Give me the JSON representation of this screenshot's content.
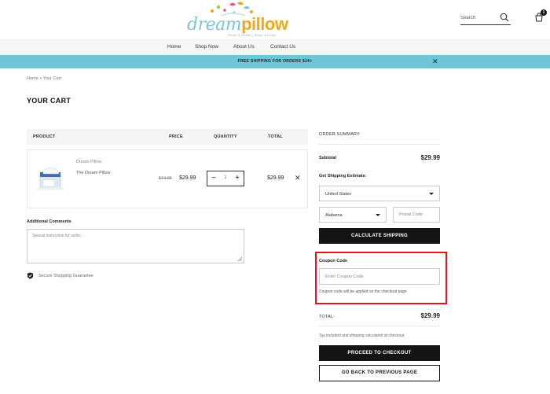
{
  "header": {
    "logo": {
      "part1": "dream",
      "part2": "pillow",
      "tagline": "Relax & Dream | Sleep & Enjoy",
      "colors": {
        "part1": "#7ec3d6",
        "part2": "#f2a81d"
      }
    },
    "search": {
      "placeholder": "Search",
      "icon": "search-icon"
    },
    "cart": {
      "icon": "bag-icon",
      "count": "1"
    }
  },
  "nav": {
    "items": [
      "Home",
      "Shop Now",
      "About Us",
      "Contact Us"
    ]
  },
  "banner": {
    "text": "FREE SHIPPING FOR ORDERS $24+",
    "close": "✕",
    "color": "#6cc6d8"
  },
  "breadcrumb": "Home  >  Your Cart",
  "page_title": "YOUR CART",
  "cart": {
    "columns": {
      "product": "PRODUCT",
      "price": "PRICE",
      "quantity": "QUANTITY",
      "total": "TOTAL"
    },
    "items": [
      {
        "brand": "Dream Pillow",
        "name": "The Dream Pillow",
        "old_price": "$44.95",
        "price": "$29.99",
        "quantity": "1",
        "total": "$29.99"
      }
    ],
    "qty_minus": "−",
    "qty_plus": "+",
    "remove": "✕"
  },
  "comments": {
    "label": "Additional Comments",
    "placeholder": "Special instruction for seller..."
  },
  "secure": "Secure Shopping Guarantee",
  "summary": {
    "title": "ORDER SUMMARY",
    "subtotal_label": "Subtotal",
    "subtotal_value": "$29.99",
    "shipping_label": "Get Shipping Estimate:",
    "country": "United States",
    "state": "Alabama",
    "postal_placeholder": "Postal Code",
    "calculate_button": "CALCULATE SHIPPING",
    "coupon_label": "Coupon Code",
    "coupon_placeholder": "Enter Coupon Code",
    "coupon_note": "Coupon code will be applied on the checkout page",
    "total_label": "TOTAL:",
    "total_value": "$29.99",
    "tax_note": "Tax included and shipping calculated at checkout",
    "checkout_button": "PROCEED TO CHECKOUT",
    "back_button": "GO BACK TO PREVIOUS PAGE",
    "highlight_color": "#e8141c"
  }
}
